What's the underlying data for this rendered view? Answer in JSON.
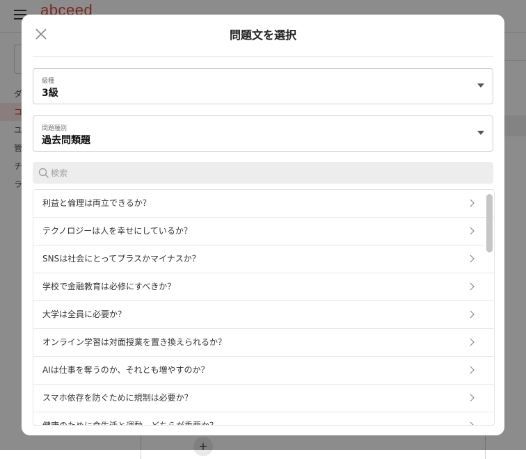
{
  "app": {
    "brand": "abceed",
    "nav_items": [
      "ダ",
      "コ",
      "ユ",
      "管",
      "チ",
      "ラ"
    ]
  },
  "modal": {
    "title": "問題文を選択",
    "fields": [
      {
        "label": "級種",
        "value": "3級"
      },
      {
        "label": "問題種別",
        "value": "過去問類題"
      }
    ],
    "search": {
      "placeholder": "検索",
      "value": ""
    },
    "items": [
      "利益と倫理は両立できるか？",
      "テクノロジーは人を幸せにしているか？",
      "SNSは社会にとってプラスかマイナスか？",
      "学校で金融教育は必修にすべきか？",
      "大学は全員に必要か？",
      "オンライン学習は対面授業を置き換えられるか？",
      "AIは仕事を奪うのか、それとも増やすのか？",
      "スマホ依存を防ぐために規制は必要か？",
      "健康のために食生活と運動、どちらが重要か？"
    ]
  },
  "colors": {
    "brand": "#e0473c",
    "overlay": "rgba(0,0,0,0.45)",
    "active_nav_bg": "#fbe3e3"
  },
  "icons": {
    "menu": "hamburger-icon",
    "close": "close-icon",
    "search": "search-icon",
    "caret": "caret-down-icon",
    "chevron": "chevron-right-icon",
    "add": "plus-icon"
  }
}
